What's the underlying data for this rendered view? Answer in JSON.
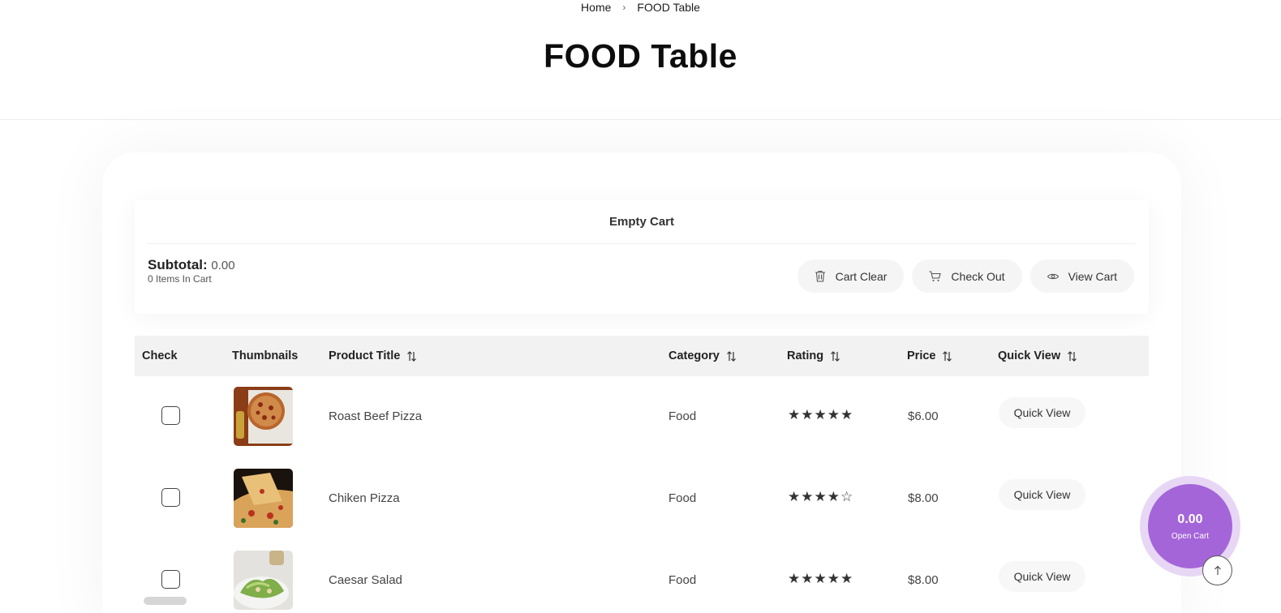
{
  "breadcrumb": {
    "home": "Home",
    "current": "FOOD Table"
  },
  "page": {
    "title": "FOOD Table"
  },
  "cart": {
    "empty_label": "Empty Cart",
    "subtotal_label": "Subtotal:",
    "subtotal_value": "0.00",
    "items_count": "0 Items In Cart",
    "buttons": {
      "clear": "Cart Clear",
      "checkout": "Check Out",
      "view": "View Cart"
    }
  },
  "table": {
    "columns": [
      "Check",
      "Thumbnails",
      "Product Title",
      "Category",
      "Rating",
      "Price",
      "Quick View"
    ],
    "rows": [
      {
        "title": "Roast Beef Pizza",
        "category": "Food",
        "rating": 5,
        "stars": "★★★★★",
        "price": "$6.00",
        "quick_view": "Quick View"
      },
      {
        "title": "Chiken Pizza",
        "category": "Food",
        "rating": 4,
        "stars": "★★★★☆",
        "price": "$8.00",
        "quick_view": "Quick View"
      },
      {
        "title": "Caesar Salad",
        "category": "Food",
        "rating": 5,
        "stars": "★★★★★",
        "price": "$8.00",
        "quick_view": "Quick View"
      }
    ]
  },
  "floating_cart": {
    "total": "0.00",
    "label": "Open Cart"
  },
  "colors": {
    "accent": "#a465d9",
    "accent_ring": "#e7d7f5",
    "header_bg": "#f2f2f2"
  }
}
